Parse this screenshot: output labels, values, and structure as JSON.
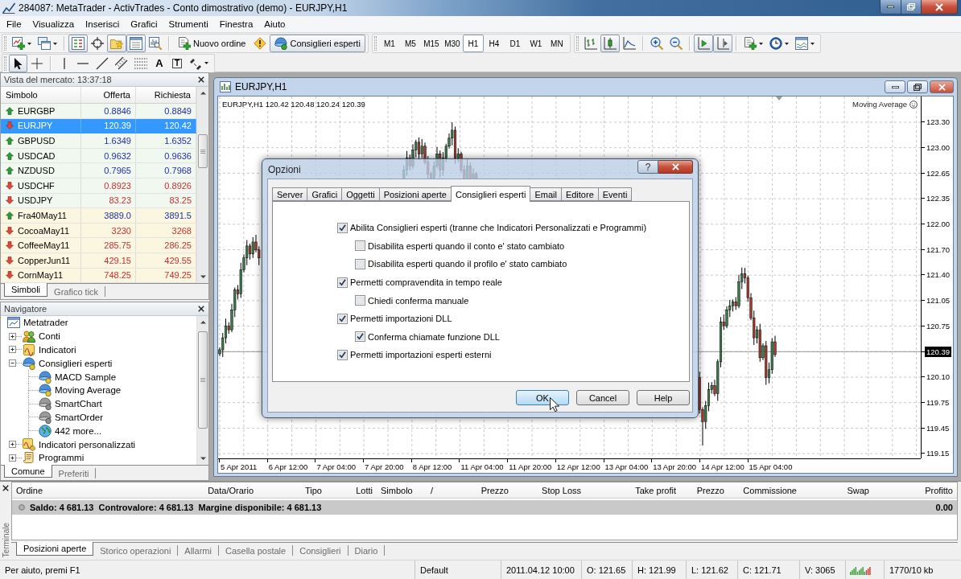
{
  "window": {
    "title": "284087: MetaTrader - ActivTrades - Conto dimostrativo (demo) - EURJPY,H1"
  },
  "menu": [
    "File",
    "Visualizza",
    "Inserisci",
    "Grafici",
    "Strumenti",
    "Finestra",
    "Aiuto"
  ],
  "toolbar": [
    {
      "kind": "icon",
      "pressed": false,
      "dropdown": true
    },
    {
      "kind": "icon",
      "pressed": false,
      "dropdown": true
    },
    {
      "kind": "separator"
    },
    {
      "kind": "icon",
      "pressed": true,
      "dropdown": false
    },
    {
      "kind": "icon",
      "pressed": false,
      "dropdown": false
    },
    {
      "kind": "icon",
      "pressed": true,
      "dropdown": false
    },
    {
      "kind": "icon",
      "pressed": true,
      "dropdown": false
    },
    {
      "kind": "icon",
      "pressed": false,
      "dropdown": false
    },
    {
      "kind": "separator"
    },
    {
      "kind": "text",
      "label": "Nuovo ordine",
      "pressed": false,
      "dropdown": false
    },
    {
      "kind": "icon",
      "pressed": false,
      "dropdown": false
    },
    {
      "kind": "text",
      "label": "Consiglieri esperti",
      "pressed": true,
      "dropdown": false
    }
  ],
  "timeframes": [
    {
      "label": "M1",
      "selected": false
    },
    {
      "label": "M5",
      "selected": false
    },
    {
      "label": "M15",
      "selected": false
    },
    {
      "label": "M30",
      "selected": false
    },
    {
      "label": "H1",
      "selected": true
    },
    {
      "label": "H4",
      "selected": false
    },
    {
      "label": "D1",
      "selected": false
    },
    {
      "label": "W1",
      "selected": false
    },
    {
      "label": "MN",
      "selected": false
    }
  ],
  "chart_tools": [
    {
      "kind": "icon",
      "pressed": false,
      "dropdown": false
    },
    {
      "kind": "icon",
      "pressed": true,
      "dropdown": false
    },
    {
      "kind": "icon",
      "pressed": false,
      "dropdown": false
    },
    {
      "kind": "separator"
    },
    {
      "kind": "icon",
      "pressed": false,
      "dropdown": false
    },
    {
      "kind": "icon",
      "pressed": false,
      "dropdown": false
    },
    {
      "kind": "separator"
    },
    {
      "kind": "icon",
      "pressed": true,
      "dropdown": false
    },
    {
      "kind": "icon",
      "pressed": true,
      "dropdown": false
    },
    {
      "kind": "separator"
    },
    {
      "kind": "icon",
      "pressed": false,
      "dropdown": true
    },
    {
      "kind": "icon",
      "pressed": false,
      "dropdown": true
    },
    {
      "kind": "icon",
      "pressed": false,
      "dropdown": true
    }
  ],
  "drawing_tools": [
    {
      "kind": "icon",
      "pressed": true,
      "dropdown": false
    },
    {
      "kind": "icon",
      "pressed": false,
      "dropdown": false
    },
    {
      "kind": "separator"
    },
    {
      "kind": "icon",
      "pressed": false,
      "dropdown": false
    },
    {
      "kind": "icon",
      "pressed": false,
      "dropdown": false
    },
    {
      "kind": "icon",
      "pressed": false,
      "dropdown": false
    },
    {
      "kind": "icon",
      "pressed": false,
      "dropdown": false
    },
    {
      "kind": "icon",
      "pressed": false,
      "dropdown": false
    },
    {
      "kind": "glyph",
      "glyph": "A",
      "pressed": false,
      "dropdown": false
    },
    {
      "kind": "boxed_glyph",
      "glyph": "T",
      "pressed": false,
      "dropdown": false
    },
    {
      "kind": "icon",
      "pressed": false,
      "dropdown": true
    }
  ],
  "market_watch": {
    "title": "Vista del mercato: 13:37:18",
    "columns": [
      "Simbolo",
      "Offerta",
      "Richiesta"
    ],
    "rows": [
      {
        "symbol": "EURGBP",
        "bid": "0.8846",
        "ask": "0.8849",
        "rising": true,
        "kind": "currency",
        "selected": false
      },
      {
        "symbol": "EURJPY",
        "bid": "120.39",
        "ask": "120.42",
        "rising": false,
        "kind": "currency",
        "selected": true
      },
      {
        "symbol": "GBPUSD",
        "bid": "1.6349",
        "ask": "1.6352",
        "rising": true,
        "kind": "currency",
        "selected": false
      },
      {
        "symbol": "USDCAD",
        "bid": "0.9632",
        "ask": "0.9636",
        "rising": true,
        "kind": "currency",
        "selected": false
      },
      {
        "symbol": "NZDUSD",
        "bid": "0.7965",
        "ask": "0.7968",
        "rising": true,
        "kind": "currency",
        "selected": false
      },
      {
        "symbol": "USDCHF",
        "bid": "0.8923",
        "ask": "0.8926",
        "rising": false,
        "kind": "currency",
        "selected": false
      },
      {
        "symbol": "USDJPY",
        "bid": "83.23",
        "ask": "83.25",
        "rising": false,
        "kind": "currency",
        "selected": false
      },
      {
        "symbol": "Fra40May11",
        "bid": "3889.0",
        "ask": "3891.5",
        "rising": true,
        "kind": "future",
        "selected": false
      },
      {
        "symbol": "CocoaMay11",
        "bid": "3230",
        "ask": "3268",
        "rising": false,
        "kind": "future",
        "selected": false
      },
      {
        "symbol": "CoffeeMay11",
        "bid": "285.75",
        "ask": "286.25",
        "rising": false,
        "kind": "future",
        "selected": false
      },
      {
        "symbol": "CopperJun11",
        "bid": "429.15",
        "ask": "429.55",
        "rising": false,
        "kind": "future",
        "selected": false
      },
      {
        "symbol": "CornMay11",
        "bid": "748.25",
        "ask": "749.25",
        "rising": false,
        "kind": "future",
        "selected": false
      }
    ],
    "tabs": [
      {
        "label": "Simboli",
        "selected": true
      },
      {
        "label": "Grafico tick",
        "selected": false
      }
    ]
  },
  "navigator": {
    "title": "Navigatore",
    "tree": [
      {
        "label": "Metatrader",
        "kind": "terminal",
        "children": [
          {
            "label": "Conti",
            "kind": "accounts",
            "expanded": false
          },
          {
            "label": "Indicatori",
            "kind": "indicators",
            "expanded": false
          },
          {
            "label": "Consiglieri esperti",
            "kind": "experts",
            "expanded": true,
            "children": [
              {
                "label": "MACD Sample",
                "kind": "expert"
              },
              {
                "label": "Moving Average",
                "kind": "expert"
              },
              {
                "label": "SmartChart",
                "kind": "expert_inactive"
              },
              {
                "label": "SmartOrder",
                "kind": "expert_inactive"
              },
              {
                "label": "442 more...",
                "kind": "more"
              }
            ]
          },
          {
            "label": "Indicatori personalizzati",
            "kind": "custom_indicators",
            "expanded": false
          },
          {
            "label": "Programmi",
            "kind": "scripts",
            "expanded": false
          }
        ]
      }
    ],
    "tabs": [
      {
        "label": "Comune",
        "selected": true
      },
      {
        "label": "Preferiti",
        "selected": false
      }
    ]
  },
  "chart": {
    "title": "EURJPY,H1",
    "info": "EURJPY,H1 120.42 120.48 120.24 120.39",
    "expert": "Moving Average",
    "price_axis": [
      {
        "label": "123.30",
        "current": false
      },
      {
        "label": "123.00",
        "current": false
      },
      {
        "label": "122.65",
        "current": false
      },
      {
        "label": "122.35",
        "current": false
      },
      {
        "label": "122.00",
        "current": false
      },
      {
        "label": "121.70",
        "current": false
      },
      {
        "label": "121.40",
        "current": false
      },
      {
        "label": "121.05",
        "current": false
      },
      {
        "label": "120.75",
        "current": false
      },
      {
        "label": "120.39",
        "current": true
      },
      {
        "label": "120.10",
        "current": false
      },
      {
        "label": "119.75",
        "current": false
      },
      {
        "label": "119.45",
        "current": false
      },
      {
        "label": "119.15",
        "current": false
      }
    ],
    "time_axis": [
      "5 Apr 2011",
      "6 Apr 12:00",
      "7 Apr 04:00",
      "7 Apr 20:00",
      "8 Apr 12:00",
      "11 Apr 04:00",
      "11 Apr 20:00",
      "12 Apr 12:00",
      "13 Apr 04:00",
      "13 Apr 20:00",
      "14 Apr 12:00",
      "15 Apr 04:00"
    ]
  },
  "dialog": {
    "title": "Opzioni",
    "help_glyph": "?",
    "tabs": [
      {
        "label": "Server",
        "selected": false
      },
      {
        "label": "Grafici",
        "selected": false
      },
      {
        "label": "Oggetti",
        "selected": false
      },
      {
        "label": "Posizioni aperte",
        "selected": false
      },
      {
        "label": "Consiglieri esperti",
        "selected": true
      },
      {
        "label": "Email",
        "selected": false
      },
      {
        "label": "Editore",
        "selected": false
      },
      {
        "label": "Eventi",
        "selected": false
      }
    ],
    "options": [
      {
        "label": "Abilita Consiglieri esperti (tranne che Indicatori Personalizzati e Programmi)",
        "checked": true,
        "children": [
          {
            "label": "Disabilita esperti quando il conto e' stato cambiato",
            "checked": false
          },
          {
            "label": "Disabilita esperti quando il profilo e' stato cambiato",
            "checked": false
          }
        ]
      },
      {
        "label": "Permetti compravendita in tempo reale",
        "checked": true,
        "children": [
          {
            "label": "Chiedi conferma manuale",
            "checked": false
          }
        ]
      },
      {
        "label": "Permetti importazioni DLL",
        "checked": true,
        "children": [
          {
            "label": "Conferma chiamate funzione DLL",
            "checked": true
          }
        ]
      },
      {
        "label": "Permetti importazioni esperti esterni",
        "checked": true
      }
    ],
    "buttons": [
      {
        "label": "OK",
        "focused": true
      },
      {
        "label": "Cancel",
        "focused": false
      },
      {
        "label": "Help",
        "focused": false
      }
    ]
  },
  "terminal": {
    "title": "Terminale",
    "columns": [
      "Ordine",
      "Data/Orario",
      "Tipo",
      "Lotti",
      "Simbolo",
      "/",
      "Prezzo",
      "Stop Loss",
      "Take profit",
      "Prezzo",
      "Commissione",
      "Swap",
      "Profitto"
    ],
    "balance": [
      "Saldo: 4 681.13",
      "Controvalore: 4 681.13",
      "Margine disponibile: 4 681.13"
    ],
    "profit": "0.00",
    "tabs": [
      {
        "label": "Posizioni aperte",
        "selected": true
      },
      {
        "label": "Storico operazioni",
        "selected": false
      },
      {
        "label": "Allarmi",
        "selected": false
      },
      {
        "label": "Casella postale",
        "selected": false
      },
      {
        "label": "Consiglieri",
        "selected": false
      },
      {
        "label": "Diario",
        "selected": false
      }
    ]
  },
  "status_bar": {
    "help": "Per aiuto, premi F1",
    "profile": "Default",
    "bar_time": "2011.04.12 10:00",
    "open": "O: 121.65",
    "high": "H: 121.99",
    "low": "L: 121.62",
    "close": "C: 121.71",
    "volume": "V: 3065",
    "traffic": "1770/10 kb"
  }
}
